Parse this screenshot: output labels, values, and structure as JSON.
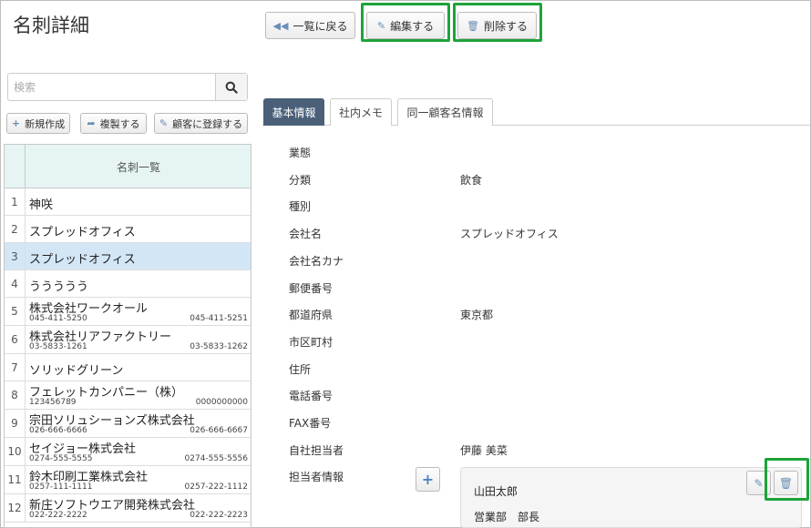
{
  "page": {
    "title": "名刺詳細"
  },
  "toolbar": {
    "back_label": "一覧に戻る",
    "edit_label": "編集する",
    "delete_label": "削除する"
  },
  "search": {
    "placeholder": "検索"
  },
  "actions": {
    "new_label": "新規作成",
    "copy_label": "複製する",
    "register_label": "顧客に登録する"
  },
  "list": {
    "header": "名刺一覧",
    "rows": [
      {
        "num": "1",
        "name": "神咲",
        "sub_left": "",
        "sub_right": ""
      },
      {
        "num": "2",
        "name": "スプレッドオフィス",
        "sub_left": "",
        "sub_right": ""
      },
      {
        "num": "3",
        "name": "スプレッドオフィス",
        "sub_left": "",
        "sub_right": ""
      },
      {
        "num": "4",
        "name": "ううううう",
        "sub_left": "",
        "sub_right": ""
      },
      {
        "num": "5",
        "name": "株式会社ワークオール",
        "sub_left": "045-411-5250",
        "sub_right": "045-411-5251"
      },
      {
        "num": "6",
        "name": "株式会社リアファクトリー",
        "sub_left": "03-5833-1261",
        "sub_right": "03-5833-1262"
      },
      {
        "num": "7",
        "name": "ソリッドグリーン",
        "sub_left": "",
        "sub_right": ""
      },
      {
        "num": "8",
        "name": "フェレットカンパニー（株）",
        "sub_left": "123456789",
        "sub_right": "0000000000"
      },
      {
        "num": "9",
        "name": "宗田ソリュシーョンズ株式会社",
        "sub_left": "026-666-6666",
        "sub_right": "026-666-6667"
      },
      {
        "num": "10",
        "name": "セイジョー株式会社",
        "sub_left": "0274-555-5555",
        "sub_right": "0274-555-5556"
      },
      {
        "num": "11",
        "name": "鈴木印刷工業株式会社",
        "sub_left": "0257-111-1111",
        "sub_right": "0257-222-1112"
      },
      {
        "num": "12",
        "name": "新庄ソフトウエア開発株式会社",
        "sub_left": "022-222-2222",
        "sub_right": "022-222-2223"
      }
    ]
  },
  "tabs": [
    "基本情報",
    "社内メモ",
    "同一顧客名情報"
  ],
  "fields": [
    {
      "label": "業態",
      "value": ""
    },
    {
      "label": "分類",
      "value": "飲食"
    },
    {
      "label": "種別",
      "value": ""
    },
    {
      "label": "会社名",
      "value": "スプレッドオフィス"
    },
    {
      "label": "会社名カナ",
      "value": ""
    },
    {
      "label": "郵便番号",
      "value": ""
    },
    {
      "label": "都道府県",
      "value": "東京都"
    },
    {
      "label": "市区町村",
      "value": ""
    },
    {
      "label": "住所",
      "value": ""
    },
    {
      "label": "電話番号",
      "value": ""
    },
    {
      "label": "FAX番号",
      "value": ""
    },
    {
      "label": "自社担当者",
      "value": "伊藤 美菜"
    },
    {
      "label": "担当者情報",
      "value": ""
    }
  ],
  "contact": {
    "name": "山田太郎",
    "dept": "営業部　部長"
  },
  "colors": {
    "highlight": "#1ea33a",
    "active_tab": "#4a6079",
    "selected_row": "#d3e6f6",
    "icon": "#6b8fb6"
  },
  "icons": [
    "back-icon",
    "pencil-icon",
    "trash-icon",
    "search-icon",
    "plus-icon",
    "share-icon"
  ]
}
